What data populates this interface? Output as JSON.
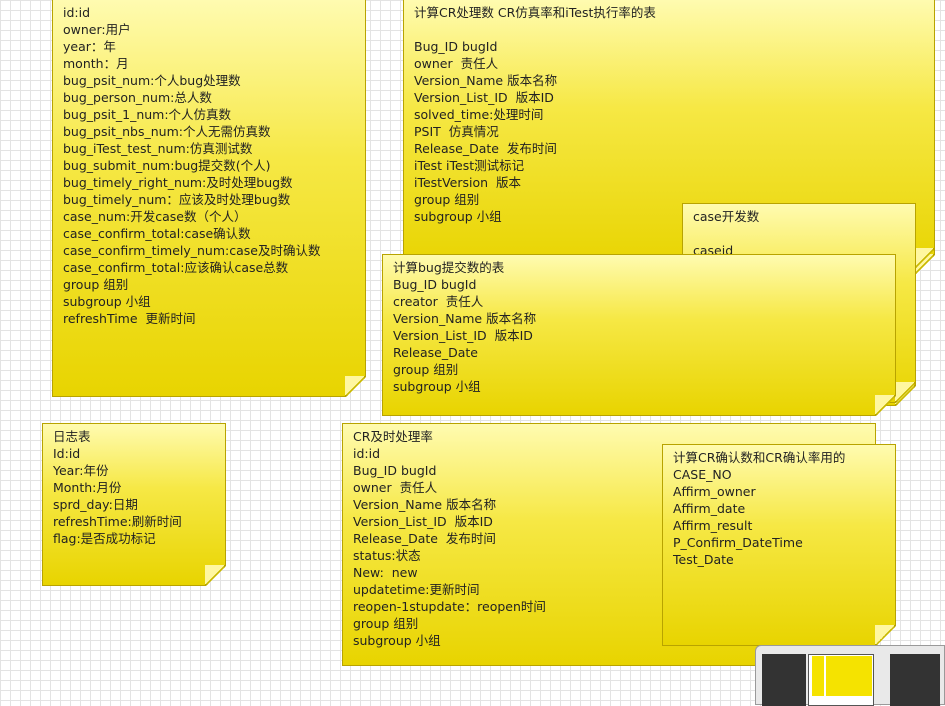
{
  "notes": {
    "stats": {
      "lines": [
        "id:id",
        "owner:用户",
        "year：年",
        "month：月",
        "bug_psit_num:个人bug处理数",
        "bug_person_num:总人数",
        "bug_psit_1_num:个人仿真数",
        "bug_psit_nbs_num:个人无需仿真数",
        "bug_iTest_test_num:仿真测试数",
        "bug_submit_num:bug提交数(个人)",
        "bug_timely_right_num:及时处理bug数",
        "bug_timely_num：应该及时处理bug数",
        "case_num:开发case数（个人）",
        "case_confirm_total:case确认数",
        "case_confirm_timely_num:case及时确认数",
        "case_confirm_total:应该确认case总数",
        "group 组别",
        "subgroup 小组",
        "refreshTime  更新时间"
      ]
    },
    "cr_process": {
      "lines": [
        "计算CR处理数 CR仿真率和iTest执行率的表",
        "",
        "Bug_ID bugId",
        "owner  责任人",
        "Version_Name 版本名称",
        "Version_List_ID  版本ID",
        "solved_time:处理时间",
        "PSIT  仿真情况",
        "Release_Date  发布时间",
        "iTest iTest测试标记",
        "iTestVersion  版本",
        "group 组别",
        "subgroup 小组"
      ]
    },
    "case_dev": {
      "lines": [
        "case开发数",
        "",
        "caseid"
      ]
    },
    "bug_submit": {
      "lines": [
        "计算bug提交数的表",
        "Bug_ID bugId",
        "creator  责任人",
        "Version_Name 版本名称",
        "Version_List_ID  版本ID",
        "Release_Date",
        "group 组别",
        "subgroup 小组"
      ]
    },
    "log": {
      "lines": [
        "日志表",
        "Id:id",
        "Year:年份",
        "Month:月份",
        "sprd_day:日期",
        "refreshTime:刷新时间",
        "flag:是否成功标记"
      ]
    },
    "cr_timely": {
      "lines": [
        "CR及时处理率",
        "id:id",
        "Bug_ID bugId",
        "owner  责任人",
        "Version_Name 版本名称",
        "Version_List_ID  版本ID",
        "Release_Date  发布时间",
        "status:状态",
        "New:  new",
        "updatetime:更新时间",
        "reopen-1stupdate：reopen时间",
        "group 组别",
        "subgroup 小组"
      ]
    },
    "cr_confirm": {
      "lines": [
        "计算CR确认数和CR确认率用的",
        "CASE_NO",
        "Affirm_owner",
        "Affirm_date",
        "Affirm_result",
        "P_Confirm_DateTime",
        "Test_Date"
      ]
    }
  },
  "colors": {
    "note_fill": "#f6e845",
    "note_border": "#b8a300"
  }
}
